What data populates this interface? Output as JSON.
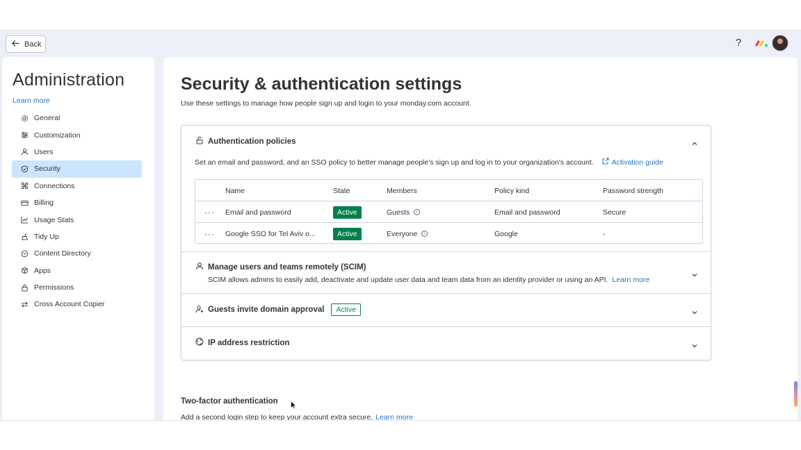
{
  "topbar": {
    "back_label": "Back",
    "help_label": "?"
  },
  "sidebar": {
    "title": "Administration",
    "learn_more": "Learn more",
    "items": [
      {
        "label": "General",
        "icon": "gear-icon"
      },
      {
        "label": "Customization",
        "icon": "sliders-icon"
      },
      {
        "label": "Users",
        "icon": "user-icon"
      },
      {
        "label": "Security",
        "icon": "shield-icon",
        "active": true
      },
      {
        "label": "Connections",
        "icon": "connections-icon"
      },
      {
        "label": "Billing",
        "icon": "card-icon"
      },
      {
        "label": "Usage Stats",
        "icon": "chart-icon"
      },
      {
        "label": "Tidy Up",
        "icon": "broom-icon"
      },
      {
        "label": "Content Directory",
        "icon": "folder-icon"
      },
      {
        "label": "Apps",
        "icon": "apps-icon"
      },
      {
        "label": "Permissions",
        "icon": "lock-icon"
      },
      {
        "label": "Cross Account Copier",
        "icon": "arrows-icon"
      }
    ]
  },
  "main": {
    "title": "Security & authentication settings",
    "subtitle": "Use these settings to manage how people sign up and login to your monday.com account.",
    "auth": {
      "heading": "Authentication policies",
      "description": "Set an email and password, and an SSO policy to better manage people's sign up and log in to your organization's account.",
      "guide_label": "Activation guide",
      "columns": [
        "Name",
        "State",
        "Members",
        "Policy kind",
        "Password strength"
      ],
      "rows": [
        {
          "name": "Email and password",
          "state": "Active",
          "members": "Guests",
          "kind": "Email and password",
          "strength": "Secure"
        },
        {
          "name": "Google SSO for Tel Aviv o...",
          "state": "Active",
          "members": "Everyone",
          "kind": "Google",
          "strength": "-"
        }
      ]
    },
    "scim": {
      "heading": "Manage users and teams remotely (SCIM)",
      "description": "SCIM allows admins to easily add, deactivate and update user data and team data from an identity provider or using an API.",
      "learn_more": "Learn more"
    },
    "guests": {
      "heading": "Guests invite domain approval",
      "badge": "Active"
    },
    "ip": {
      "heading": "IP address restriction"
    },
    "tfa": {
      "heading": "Two-factor authentication",
      "description": "Add a second login step to keep your account extra secure.",
      "learn_more": "Learn more"
    }
  },
  "colors": {
    "accent": "#1f76c2",
    "active_green": "#037f4c",
    "selected_bg": "#cce5ff"
  }
}
